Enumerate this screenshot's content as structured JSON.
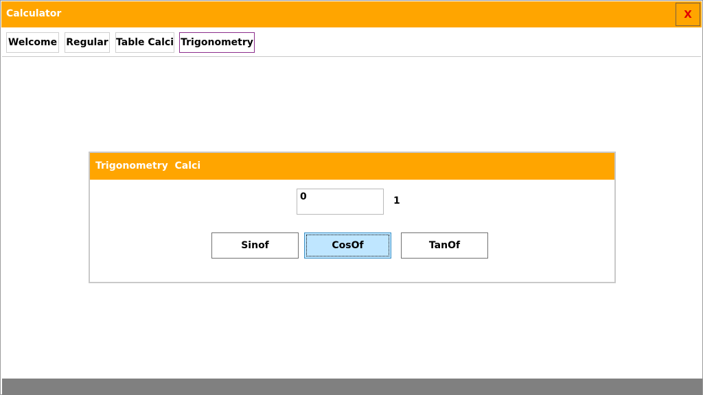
{
  "window": {
    "title": "Calculator",
    "close_label": "X"
  },
  "tabs": [
    {
      "label": "Welcome"
    },
    {
      "label": "Regular"
    },
    {
      "label": "Table Calci"
    },
    {
      "label": "Trigonometry"
    }
  ],
  "panel": {
    "title": "Trigonometry  Calci",
    "input_value": "0",
    "result": "1",
    "buttons": {
      "sin": "Sinof",
      "cos": "CosOf",
      "tan": "TanOf"
    }
  },
  "colors": {
    "accent": "#ffa500",
    "close_text": "#e00000",
    "focused_button": "#bfe6ff"
  }
}
